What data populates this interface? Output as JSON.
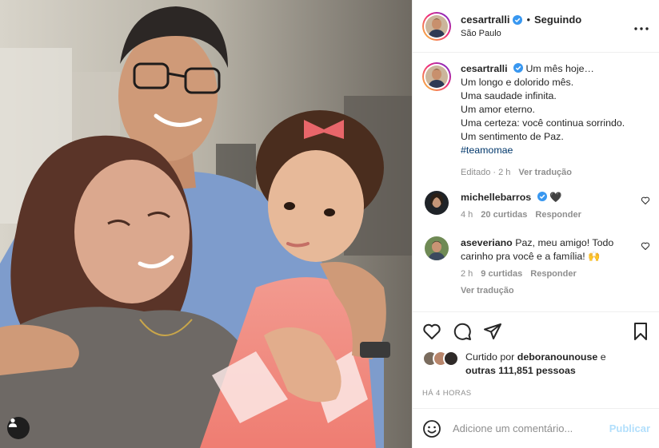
{
  "header": {
    "username": "cesartralli",
    "separator": "•",
    "follow_status": "Seguindo",
    "location": "São Paulo",
    "more_icon": "more-horizontal-icon"
  },
  "caption": {
    "username": "cesartralli",
    "lines": [
      "Um mês hoje…",
      "Um longo e dolorido mês.",
      "Uma saudade infinita.",
      "Um amor eterno.",
      "Uma certeza: você continua sorrindo.",
      "Um sentimento de Paz."
    ],
    "hashtag": "#teamomae",
    "edited": "Editado · 2 h",
    "translate": "Ver tradução"
  },
  "comments": [
    {
      "username": "michellebarros",
      "text": "🖤",
      "time": "4 h",
      "likes": "20 curtidas",
      "reply": "Responder"
    },
    {
      "username": "aseveriano",
      "text": "Paz, meu amigo! Todo carinho pra você e a família! 🙌",
      "time": "2 h",
      "likes": "9 curtidas",
      "reply": "Responder",
      "translate": "Ver tradução"
    }
  ],
  "likes": {
    "prefix": "Curtido por ",
    "user": "deboranounouse",
    "middle": " e",
    "others": "outras 111,851 pessoas"
  },
  "time_ago": "HÁ 4 HORAS",
  "add_comment": {
    "placeholder": "Adicione um comentário...",
    "publish_label": "Publicar"
  },
  "colors": {
    "verified": "#3897f0",
    "link": "#00376b",
    "muted": "#8e8e8e",
    "publish_disabled": "#b2dffc"
  }
}
